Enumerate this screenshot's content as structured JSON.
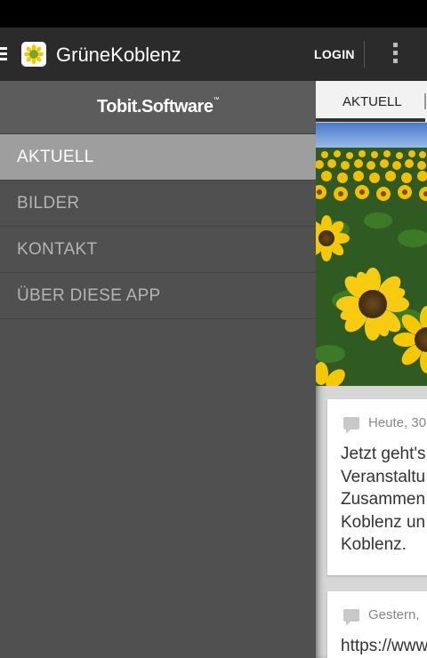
{
  "app_bar": {
    "title": "GrüneKoblenz",
    "login_label": "LOGIN"
  },
  "drawer": {
    "brand": "Tobit.Software",
    "brand_tm": "™",
    "items": [
      {
        "label": "AKTUELL",
        "active": true
      },
      {
        "label": "BILDER",
        "active": false
      },
      {
        "label": "KONTAKT",
        "active": false
      },
      {
        "label": "ÜBER DIESE APP",
        "active": false
      }
    ]
  },
  "content": {
    "tabs": [
      {
        "label": "AKTUELL"
      }
    ],
    "posts": [
      {
        "meta": "Heute, 30",
        "lines": [
          "Jetzt geht's",
          "Veranstaltu",
          "Zusammen",
          "Koblenz un",
          "Koblenz."
        ]
      },
      {
        "meta": "Gestern,",
        "lines": [
          "https://www"
        ]
      }
    ]
  },
  "colors": {
    "app_bar": "#2b2b2b",
    "drawer_bg": "#505050",
    "drawer_active": "#9e9e9e",
    "sunflower_yellow": "#f5c800"
  }
}
